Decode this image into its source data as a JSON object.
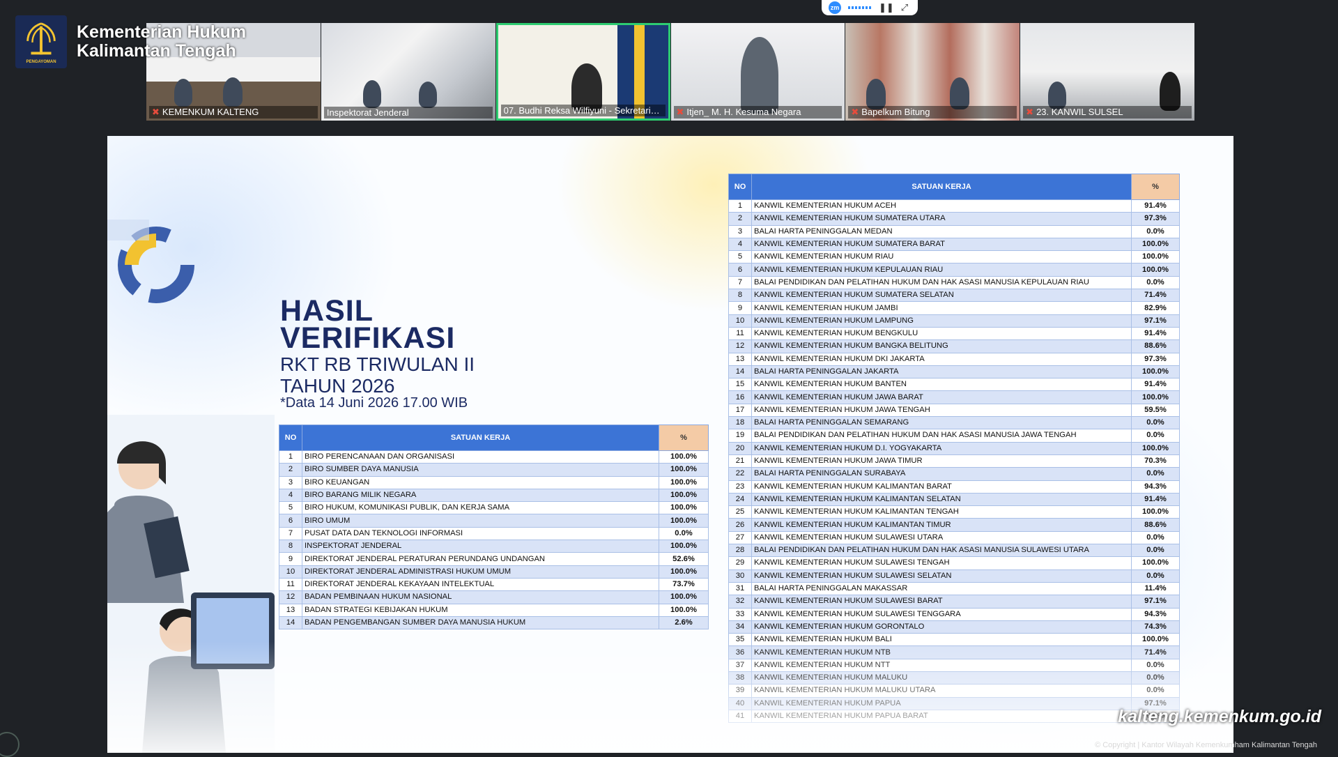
{
  "brand": {
    "line1": "Kementerian Hukum",
    "line2": "Kalimantan Tengah",
    "logo_caption": "PENGAYOMAN"
  },
  "zoom_bar": {
    "app_icon": "zm"
  },
  "tiles": [
    {
      "label": "KEMENKUM KALTENG"
    },
    {
      "label": "Inspektorat Jenderal"
    },
    {
      "label": "07. Budhi Reksa Wilfiyuni - Sekretariat ..."
    },
    {
      "label": "Itjen_ M. H. Kesuma Negara"
    },
    {
      "label": "Bapelkum Bitung"
    },
    {
      "label": "23. KANWIL SULSEL"
    }
  ],
  "headline": {
    "line1": "HASIL",
    "line2": "VERIFIKASI",
    "line3": "RKT RB TRIWULAN II",
    "line4": "TAHUN 2026",
    "line5": "*Data 14 Juni 2026 17.00 WIB"
  },
  "table_headers": {
    "no": "NO",
    "unit": "SATUAN KERJA",
    "pct": "%"
  },
  "left_table": [
    [
      "1",
      "BIRO PERENCANAAN DAN ORGANISASI",
      "100.0%"
    ],
    [
      "2",
      "BIRO SUMBER DAYA MANUSIA",
      "100.0%"
    ],
    [
      "3",
      "BIRO KEUANGAN",
      "100.0%"
    ],
    [
      "4",
      "BIRO BARANG MILIK NEGARA",
      "100.0%"
    ],
    [
      "5",
      "BIRO HUKUM, KOMUNIKASI PUBLIK, DAN KERJA SAMA",
      "100.0%"
    ],
    [
      "6",
      "BIRO UMUM",
      "100.0%"
    ],
    [
      "7",
      "PUSAT DATA DAN TEKNOLOGI INFORMASI",
      "0.0%"
    ],
    [
      "8",
      "INSPEKTORAT JENDERAL",
      "100.0%"
    ],
    [
      "9",
      "DIREKTORAT JENDERAL PERATURAN PERUNDANG UNDANGAN",
      "52.6%"
    ],
    [
      "10",
      "DIREKTORAT JENDERAL ADMINISTRASI HUKUM UMUM",
      "100.0%"
    ],
    [
      "11",
      "DIREKTORAT JENDERAL KEKAYAAN INTELEKTUAL",
      "73.7%"
    ],
    [
      "12",
      "BADAN PEMBINAAN HUKUM NASIONAL",
      "100.0%"
    ],
    [
      "13",
      "BADAN STRATEGI KEBIJAKAN HUKUM",
      "100.0%"
    ],
    [
      "14",
      "BADAN PENGEMBANGAN SUMBER DAYA MANUSIA HUKUM",
      "2.6%"
    ]
  ],
  "right_table": [
    [
      "1",
      "KANWIL KEMENTERIAN HUKUM ACEH",
      "91.4%"
    ],
    [
      "2",
      "KANWIL KEMENTERIAN HUKUM SUMATERA UTARA",
      "97.3%"
    ],
    [
      "3",
      "BALAI HARTA PENINGGALAN MEDAN",
      "0.0%"
    ],
    [
      "4",
      "KANWIL KEMENTERIAN HUKUM SUMATERA BARAT",
      "100.0%"
    ],
    [
      "5",
      "KANWIL KEMENTERIAN HUKUM RIAU",
      "100.0%"
    ],
    [
      "6",
      "KANWIL KEMENTERIAN HUKUM KEPULAUAN RIAU",
      "100.0%"
    ],
    [
      "7",
      "BALAI PENDIDIKAN DAN PELATIHAN HUKUM DAN HAK ASASI MANUSIA KEPULAUAN RIAU",
      "0.0%"
    ],
    [
      "8",
      "KANWIL KEMENTERIAN HUKUM SUMATERA SELATAN",
      "71.4%"
    ],
    [
      "9",
      "KANWIL KEMENTERIAN HUKUM JAMBI",
      "82.9%"
    ],
    [
      "10",
      "KANWIL KEMENTERIAN HUKUM LAMPUNG",
      "97.1%"
    ],
    [
      "11",
      "KANWIL KEMENTERIAN HUKUM BENGKULU",
      "91.4%"
    ],
    [
      "12",
      "KANWIL KEMENTERIAN HUKUM BANGKA BELITUNG",
      "88.6%"
    ],
    [
      "13",
      "KANWIL KEMENTERIAN HUKUM DKI JAKARTA",
      "97.3%"
    ],
    [
      "14",
      "BALAI HARTA PENINGGALAN JAKARTA",
      "100.0%"
    ],
    [
      "15",
      "KANWIL KEMENTERIAN HUKUM BANTEN",
      "91.4%"
    ],
    [
      "16",
      "KANWIL KEMENTERIAN HUKUM JAWA BARAT",
      "100.0%"
    ],
    [
      "17",
      "KANWIL KEMENTERIAN HUKUM JAWA TENGAH",
      "59.5%"
    ],
    [
      "18",
      "BALAI HARTA PENINGGALAN SEMARANG",
      "0.0%"
    ],
    [
      "19",
      "BALAI PENDIDIKAN DAN PELATIHAN HUKUM DAN HAK ASASI MANUSIA JAWA TENGAH",
      "0.0%"
    ],
    [
      "20",
      "KANWIL KEMENTERIAN HUKUM D.I. YOGYAKARTA",
      "100.0%"
    ],
    [
      "21",
      "KANWIL KEMENTERIAN HUKUM JAWA TIMUR",
      "70.3%"
    ],
    [
      "22",
      "BALAI HARTA PENINGGALAN SURABAYA",
      "0.0%"
    ],
    [
      "23",
      "KANWIL KEMENTERIAN HUKUM KALIMANTAN BARAT",
      "94.3%"
    ],
    [
      "24",
      "KANWIL KEMENTERIAN HUKUM KALIMANTAN SELATAN",
      "91.4%"
    ],
    [
      "25",
      "KANWIL KEMENTERIAN HUKUM KALIMANTAN TENGAH",
      "100.0%"
    ],
    [
      "26",
      "KANWIL KEMENTERIAN HUKUM KALIMANTAN TIMUR",
      "88.6%"
    ],
    [
      "27",
      "KANWIL KEMENTERIAN HUKUM SULAWESI UTARA",
      "0.0%"
    ],
    [
      "28",
      "BALAI PENDIDIKAN DAN PELATIHAN HUKUM DAN HAK ASASI MANUSIA SULAWESI UTARA",
      "0.0%"
    ],
    [
      "29",
      "KANWIL KEMENTERIAN HUKUM SULAWESI TENGAH",
      "100.0%"
    ],
    [
      "30",
      "KANWIL KEMENTERIAN HUKUM SULAWESI SELATAN",
      "0.0%"
    ],
    [
      "31",
      "BALAI HARTA PENINGGALAN MAKASSAR",
      "11.4%"
    ],
    [
      "32",
      "KANWIL KEMENTERIAN HUKUM SULAWESI BARAT",
      "97.1%"
    ],
    [
      "33",
      "KANWIL KEMENTERIAN HUKUM SULAWESI TENGGARA",
      "94.3%"
    ],
    [
      "34",
      "KANWIL KEMENTERIAN HUKUM GORONTALO",
      "74.3%"
    ],
    [
      "35",
      "KANWIL KEMENTERIAN HUKUM BALI",
      "100.0%"
    ],
    [
      "36",
      "KANWIL KEMENTERIAN HUKUM NTB",
      "71.4%"
    ],
    [
      "37",
      "KANWIL KEMENTERIAN HUKUM NTT",
      "0.0%"
    ],
    [
      "38",
      "KANWIL KEMENTERIAN HUKUM MALUKU",
      "0.0%"
    ],
    [
      "39",
      "KANWIL KEMENTERIAN HUKUM MALUKU UTARA",
      "0.0%"
    ],
    [
      "40",
      "KANWIL KEMENTERIAN HUKUM PAPUA",
      "97.1%"
    ],
    [
      "41",
      "KANWIL KEMENTERIAN HUKUM PAPUA BARAT",
      "0.0%"
    ]
  ],
  "footer": {
    "site": "kalteng.kemenkum.go.id",
    "copyright": "© Copyright | Kantor Wilayah Kemenkumham Kalimantan Tengah"
  },
  "colors": {
    "header_blue": "#3c74d6",
    "pct_header": "#f4cba6",
    "title_navy": "#1b2a63",
    "active_tile": "#2ecc71"
  }
}
